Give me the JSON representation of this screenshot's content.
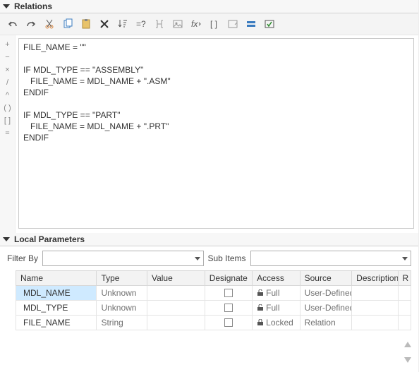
{
  "relations": {
    "title": "Relations",
    "gutter": [
      "+",
      "−",
      "×",
      "/",
      "^",
      "( )",
      "[ ]",
      "="
    ],
    "code": "FILE_NAME = \"\"\n\nIF MDL_TYPE == \"ASSEMBLY\"\n   FILE_NAME = MDL_NAME + \".ASM\"\nENDIF\n\nIF MDL_TYPE == \"PART\"\n   FILE_NAME = MDL_NAME + \".PRT\"\nENDIF"
  },
  "local_params": {
    "title": "Local Parameters",
    "filter_label": "Filter By",
    "subitems_label": "Sub Items",
    "filter_value": "",
    "subitems_value": "",
    "columns": [
      "Name",
      "Type",
      "Value",
      "Designate",
      "Access",
      "Source",
      "Description",
      "R"
    ],
    "rows": [
      {
        "name": "MDL_NAME",
        "type": "Unknown",
        "value": "",
        "designate": false,
        "access_icon": "unlocked",
        "access": "Full",
        "source": "User-Defined",
        "desc": "",
        "selected": true
      },
      {
        "name": "MDL_TYPE",
        "type": "Unknown",
        "value": "",
        "designate": false,
        "access_icon": "unlocked",
        "access": "Full",
        "source": "User-Defined",
        "desc": "",
        "selected": false
      },
      {
        "name": "FILE_NAME",
        "type": "String",
        "value": "",
        "designate": false,
        "access_icon": "locked",
        "access": "Locked",
        "source": "Relation",
        "desc": "",
        "selected": false
      }
    ]
  }
}
